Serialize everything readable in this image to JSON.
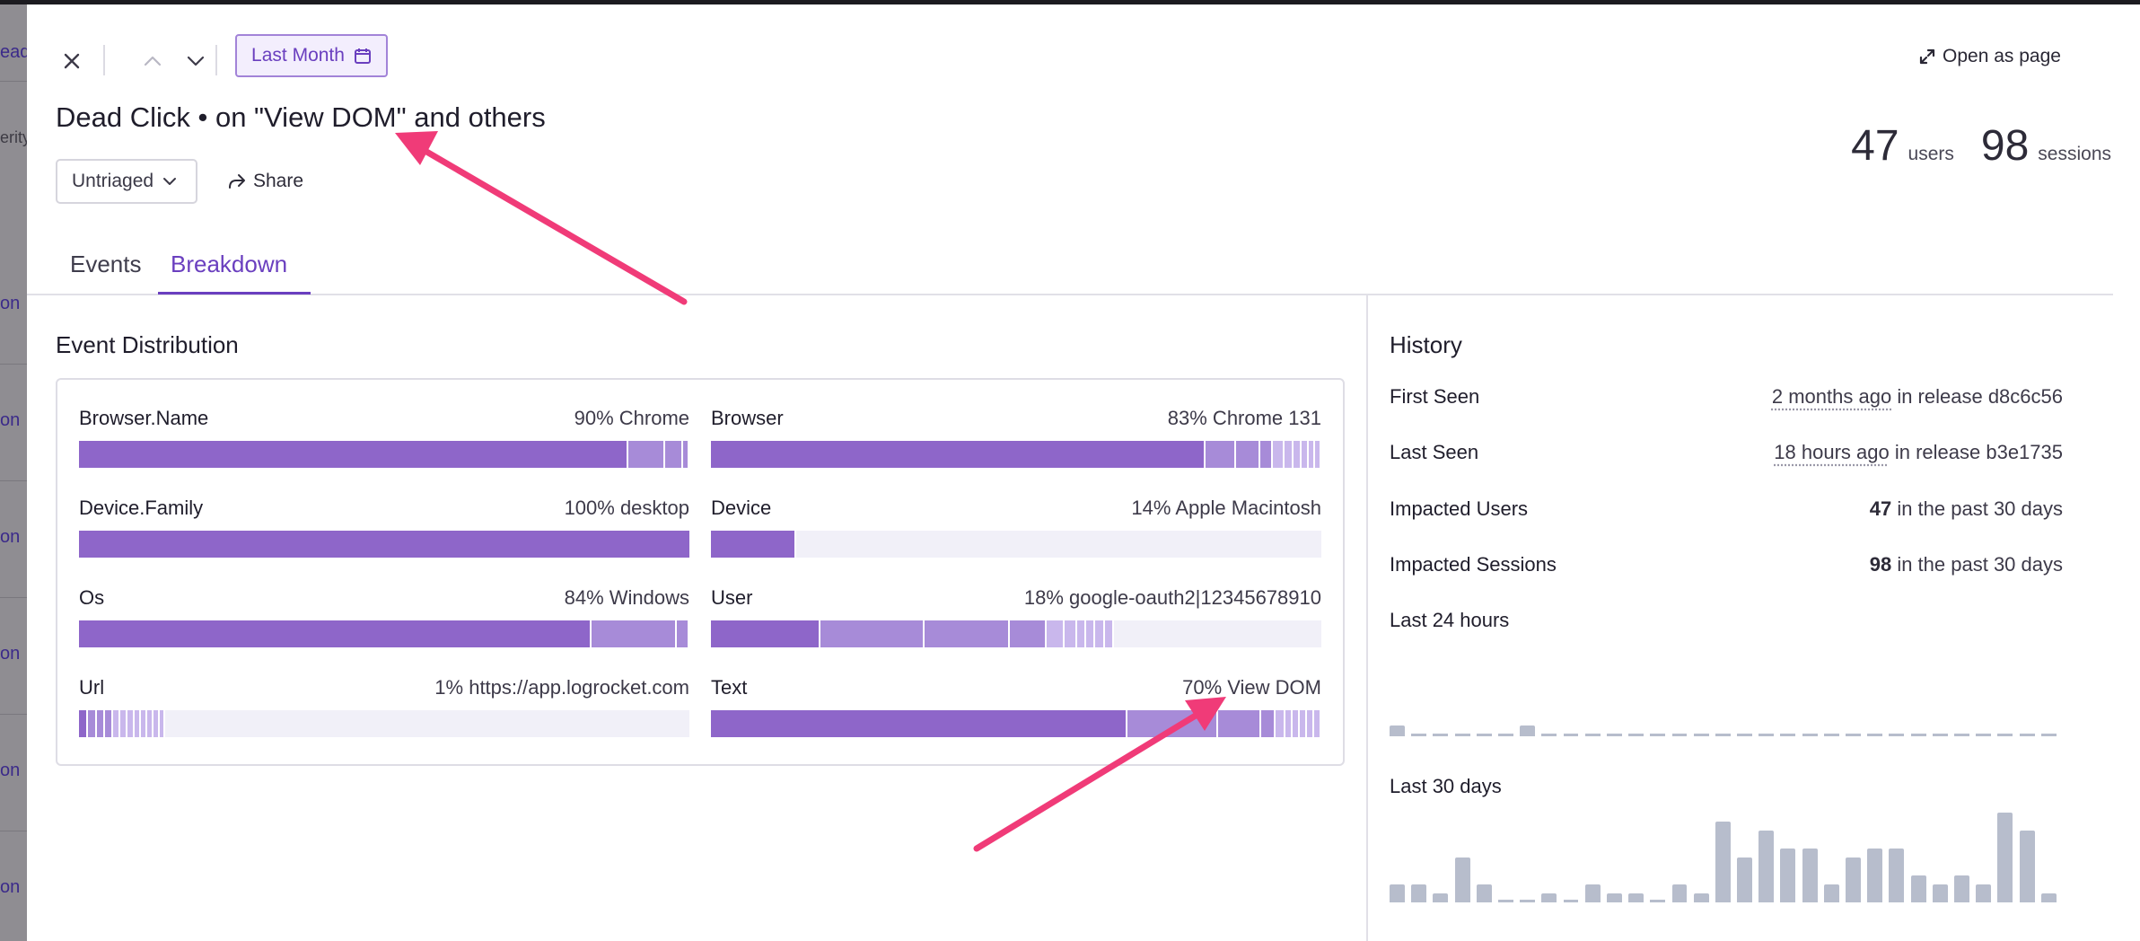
{
  "background": {
    "items": [
      {
        "label": "ead"
      },
      {
        "label": "erity"
      },
      {
        "label": "on"
      },
      {
        "label": "on"
      },
      {
        "label": "on"
      },
      {
        "label": "on"
      },
      {
        "label": "on"
      },
      {
        "label": "on"
      }
    ]
  },
  "header": {
    "date_range_label": "Last Month",
    "open_as_page_label": "Open as page",
    "title": "Dead Click • on \"View DOM\" and others",
    "status_label": "Untriaged",
    "share_label": "Share",
    "users_count": "47",
    "users_label": "users",
    "sessions_count": "98",
    "sessions_label": "sessions"
  },
  "tabs": [
    {
      "label": "Events",
      "active": false
    },
    {
      "label": "Breakdown",
      "active": true
    }
  ],
  "distribution": {
    "title": "Event Distribution",
    "cells": [
      {
        "label": "Browser.Name",
        "value": "90% Chrome",
        "segments": [
          90,
          6,
          3,
          1
        ]
      },
      {
        "label": "Browser",
        "value": "83% Chrome 131",
        "segments": [
          81,
          5,
          4,
          2,
          2,
          1.5,
          1.3,
          1.2,
          1,
          1
        ]
      },
      {
        "label": "Device.Family",
        "value": "100% desktop",
        "segments": [
          100
        ]
      },
      {
        "label": "Device",
        "value": "14% Apple Macintosh",
        "segments": [
          14
        ]
      },
      {
        "label": "Os",
        "value": "84% Windows",
        "segments": [
          84,
          14,
          2
        ]
      },
      {
        "label": "User",
        "value": "18% google-oauth2|12345678910",
        "segments": [
          18,
          17,
          14,
          6,
          3,
          2,
          1.5,
          1.5,
          1.5,
          1.5
        ]
      },
      {
        "label": "Url",
        "value": "1% https://app.logrocket.com",
        "segments": [
          1.5,
          1.5,
          1.3,
          1.3,
          1.2,
          1.2,
          1.1,
          1.1,
          1,
          1,
          1,
          1
        ]
      },
      {
        "label": "Text",
        "value": "70% View DOM",
        "segments": [
          69,
          15,
          7,
          2.5,
          1.5,
          1.2,
          1.2,
          1.2,
          1.2,
          1.2
        ]
      }
    ]
  },
  "history": {
    "title": "History",
    "first_seen_label": "First Seen",
    "first_seen_time": "2 months ago",
    "first_seen_release": "in release d8c6c56",
    "last_seen_label": "Last Seen",
    "last_seen_time": "18 hours ago",
    "last_seen_release": "in release b3e1735",
    "impacted_users_label": "Impacted Users",
    "impacted_users_count": "47",
    "impacted_users_suffix": "in the past 30 days",
    "impacted_sessions_label": "Impacted Sessions",
    "impacted_sessions_count": "98",
    "impacted_sessions_suffix": "in the past 30 days",
    "last24_label": "Last 24 hours",
    "last30_label": "Last 30 days",
    "last24_values": [
      1,
      0,
      0,
      0,
      0,
      0,
      1,
      0,
      0,
      0,
      0,
      0,
      0,
      0,
      0,
      0,
      0,
      0,
      0,
      0,
      0,
      0,
      0,
      0,
      0,
      0,
      0,
      0,
      0,
      0,
      0
    ],
    "last30_values": [
      2,
      2,
      1,
      5,
      2,
      0,
      0,
      1,
      0,
      2,
      1,
      1,
      0,
      2,
      1,
      9,
      5,
      8,
      6,
      6,
      2,
      5,
      6,
      6,
      3,
      2,
      3,
      2,
      10,
      8,
      1
    ]
  },
  "colors": {
    "accent": "#6a3fbf",
    "seg_primary": "#8e66c9",
    "seg_secondary": "#a78bd8",
    "seg_light": "#c9b7ec",
    "spark": "#b7bdcc",
    "annotation_arrow": "#f03b78"
  }
}
